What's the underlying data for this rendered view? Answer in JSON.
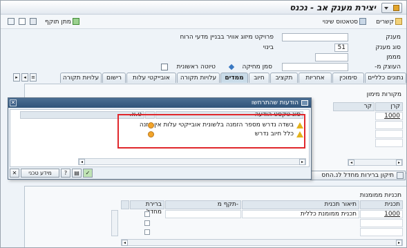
{
  "window": {
    "title": "יצירת מענק אב - נכנס"
  },
  "toolbar": {
    "items": [
      {
        "label": "קשרים"
      },
      {
        "label": "סטאטוס שינוי"
      },
      {
        "label": "מתן תוקף"
      }
    ]
  },
  "form": {
    "grant_label": "מענק",
    "grant_value": "",
    "grant_desc": "פרויקט מיזוג אוויר בבניין מדעי הרוח",
    "type_label": "סוג מענק",
    "type_value": "51",
    "type_desc": "בינוי",
    "funder_label": "מממן",
    "funder_value": "",
    "grantee_label": "העוצק מ-",
    "grantee_value": "",
    "delete_flag_label": "סמן מחיקה",
    "draft_label": "טיוטה ראשונית"
  },
  "tabs": [
    {
      "label": "נתונים כלליים"
    },
    {
      "label": "סימוכין"
    },
    {
      "label": "אחריות"
    },
    {
      "label": "תקציב"
    },
    {
      "label": "חיוב"
    },
    {
      "label": "ממדים"
    },
    {
      "label": "עלויות תקורה"
    },
    {
      "label": "אובייקטי עלות"
    },
    {
      "label": "רישום"
    },
    {
      "label": "עלויות תקורה"
    }
  ],
  "funding": {
    "section_title": "מקורות מימון",
    "col_source": "קרן",
    "col_other": "קר",
    "row_value": "1000"
  },
  "action_button": {
    "label": "תיקון ברירות מחדל לנ.החס"
  },
  "grants_program": {
    "section_title": "תכניות ממומנות",
    "columns": [
      "תכנית ממומנת",
      "תיאור תכנית",
      "תקף מ-",
      "ברירת מחדל"
    ],
    "rows": [
      {
        "program": "1000",
        "description": "תכנית ממומנת כללית"
      }
    ]
  },
  "dialog": {
    "title": "הודעות שהתרחשו",
    "col_type": "סוג טקסט הודעה",
    "col_ta": "ט.א.",
    "messages": [
      {
        "text": "בשדה נדרש מספר הזמנה בלשונית אובייקטי עלות אין הזנה"
      },
      {
        "text": "כלל חיוב נדרש"
      }
    ],
    "tech_info_label": "מידע טכני"
  }
}
